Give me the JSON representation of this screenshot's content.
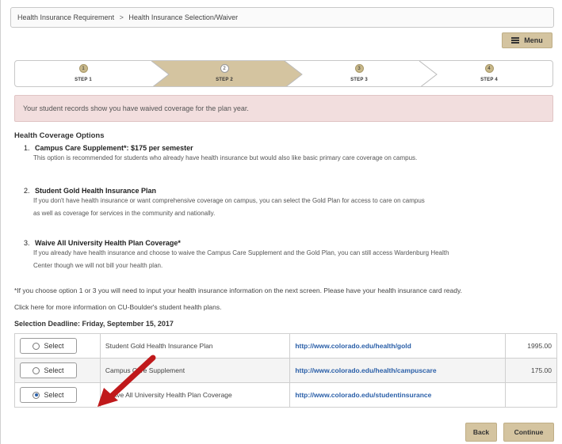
{
  "breadcrumb": {
    "items": [
      "Health Insurance Requirement",
      "Health Insurance Selection/Waiver"
    ],
    "separator": ">"
  },
  "menu": {
    "label": "Menu"
  },
  "steps": [
    {
      "number": "1",
      "label": "STEP 1",
      "state": "done"
    },
    {
      "number": "2",
      "label": "STEP 2",
      "state": "current"
    },
    {
      "number": "3",
      "label": "STEP 3",
      "state": "todo"
    },
    {
      "number": "4",
      "label": "STEP 4",
      "state": "todo"
    }
  ],
  "notice": {
    "text": "Your student records show you have waived coverage for the plan year."
  },
  "options_heading": "Health Coverage Options",
  "options": [
    {
      "number": "1.",
      "title": "Campus Care Supplement*: $175 per semester",
      "desc": [
        "This option is recommended for students who already have health insurance but would also like basic primary care coverage on campus."
      ]
    },
    {
      "number": "2.",
      "title": "Student Gold Health Insurance Plan",
      "desc": [
        "If you don't have health insurance or want comprehensive coverage on campus, you can select the Gold Plan for access to care on campus",
        "as well as coverage for services in the community and nationally."
      ]
    },
    {
      "number": "3.",
      "title": "Waive All University Health Plan Coverage*",
      "desc": [
        "If you already have health insurance and choose to waive the Campus Care Supplement and the Gold Plan, you can still access Wardenburg Health",
        "Center though we will not bill your health plan."
      ]
    }
  ],
  "footnote": "*If you choose option 1 or 3 you will need to input your health insurance information on the next screen. Please have your health insurance card ready.",
  "info_link": {
    "link": "Click here",
    "rest": " for more information on CU-Boulder's student health plans."
  },
  "deadline": "Selection Deadline: Friday, September 15, 2017",
  "plans": [
    {
      "button": "Select",
      "selected": false,
      "name": "Student Gold Health Insurance Plan",
      "url": "http://www.colorado.edu/health/gold",
      "price": "1995.00"
    },
    {
      "button": "Select",
      "selected": false,
      "name": "Campus Care Supplement",
      "url": "http://www.colorado.edu/health/campuscare",
      "price": "175.00"
    },
    {
      "button": "Select",
      "selected": true,
      "name": "Waive All University Health Plan Coverage",
      "url": "http://www.colorado.edu/studentinsurance",
      "price": ""
    }
  ],
  "buttons": {
    "back": "Back",
    "continue": "Continue"
  },
  "colors": {
    "accent": "#d4c4a0",
    "arrow": "#c0191b",
    "link": "#2a5fa8",
    "notice_bg": "#f2dede"
  }
}
